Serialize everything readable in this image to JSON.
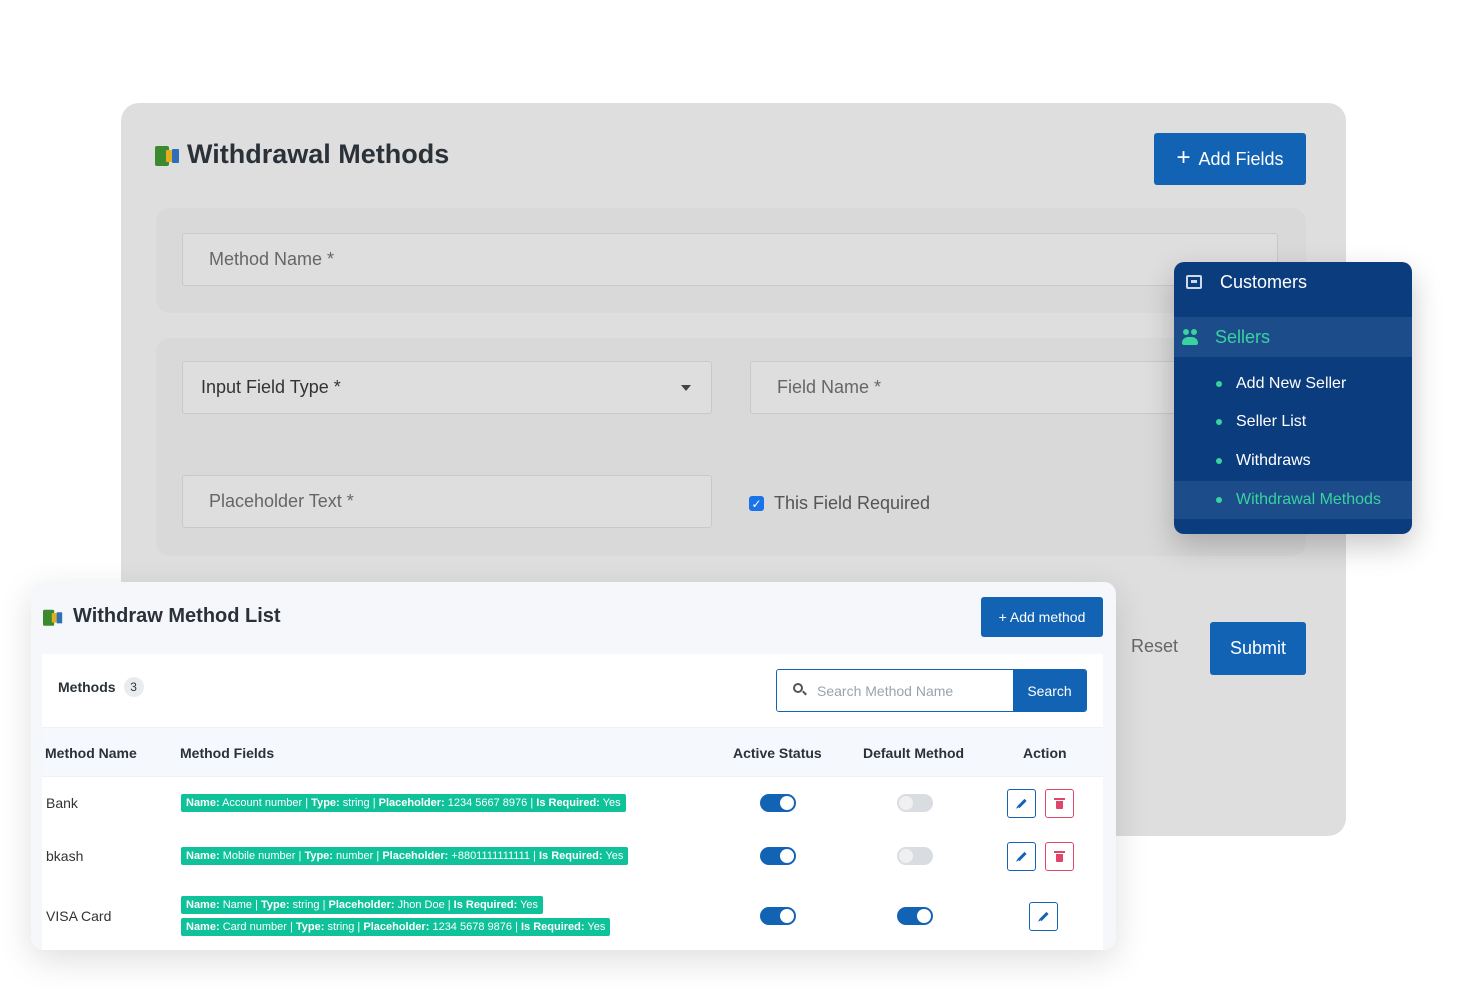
{
  "form": {
    "title": "Withdrawal Methods",
    "add_fields_label": "Add Fields",
    "method_name_placeholder": "Method Name *",
    "input_field_type_label": "Input Field Type *",
    "field_name_placeholder": "Field Name *",
    "placeholder_text_placeholder": "Placeholder Text *",
    "required_checkbox_label": "This Field Required",
    "required_checked": true,
    "reset_label": "Reset",
    "submit_label": "Submit"
  },
  "menu": {
    "customers_label": "Customers",
    "sellers_label": "Sellers",
    "items": [
      {
        "label": "Add New Seller",
        "active": false
      },
      {
        "label": "Seller List",
        "active": false
      },
      {
        "label": "Withdraws",
        "active": false
      },
      {
        "label": "Withdrawal Methods",
        "active": true
      }
    ]
  },
  "list": {
    "title": "Withdraw Method List",
    "add_method_label": "+ Add method",
    "methods_label": "Methods",
    "methods_count": "3",
    "search_placeholder": "Search Method Name",
    "search_button": "Search",
    "headers": [
      "Method Name",
      "Method Fields",
      "Active Status",
      "Default Method",
      "Action"
    ],
    "rows": [
      {
        "name": "Bank",
        "fields": [
          {
            "name": "Account number",
            "type": "string",
            "placeholder": "1234 5667 8976",
            "required": "Yes"
          }
        ],
        "active": true,
        "default": false,
        "deletable": true
      },
      {
        "name": "bkash",
        "fields": [
          {
            "name": "Mobile number",
            "type": "number",
            "placeholder": "+8801111111111",
            "required": "Yes"
          }
        ],
        "active": true,
        "default": false,
        "deletable": true
      },
      {
        "name": "VISA Card",
        "fields": [
          {
            "name": "Name",
            "type": "string",
            "placeholder": "Jhon Doe",
            "required": "Yes"
          },
          {
            "name": "Card number",
            "type": "string",
            "placeholder": "1234 5678 9876",
            "required": "Yes"
          }
        ],
        "active": true,
        "default": true,
        "deletable": false
      }
    ],
    "field_labels": {
      "name": "Name:",
      "type": "Type:",
      "placeholder": "Placeholder:",
      "required": "Is Required:"
    }
  },
  "colors": {
    "primary": "#1363b5",
    "menu_bg": "#0b3c7d",
    "menu_accent": "#38d39f",
    "chip": "#0fc29a",
    "delete": "#e0466a"
  },
  "icons": {
    "title_icon": "wallet-icon",
    "customers_icon": "box-icon",
    "sellers_icon": "people-icon",
    "search_icon": "search-icon",
    "edit_icon": "pencil-icon",
    "delete_icon": "trash-icon"
  }
}
